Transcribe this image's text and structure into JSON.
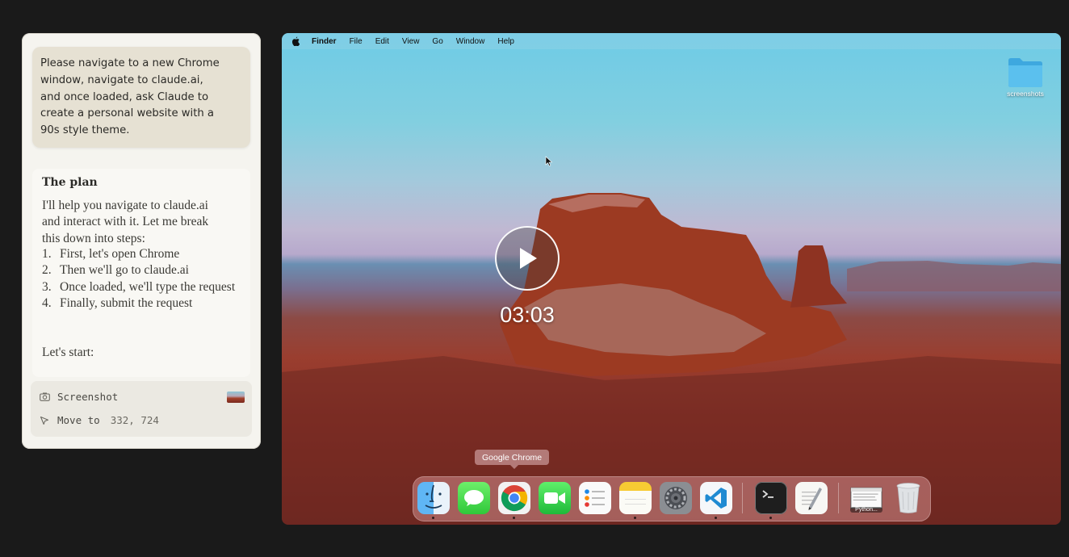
{
  "chat": {
    "user_message": "Please navigate to a new Chrome\nwindow, navigate to claude.ai,\nand once loaded, ask Claude to\ncreate a personal website with a\n90s style theme.",
    "plan_title": "The plan",
    "plan_intro": "I'll help you navigate to claude.ai\nand interact with it. Let me break\nthis down into steps:",
    "steps": [
      {
        "num": "1.",
        "text": "First, let's open Chrome"
      },
      {
        "num": "2.",
        "text": "Then we'll go to claude.ai"
      },
      {
        "num": "3.",
        "text": "Once loaded, we'll type the request"
      },
      {
        "num": "4.",
        "text": "Finally, submit the request"
      }
    ],
    "plan_outro": "Let's start:",
    "tools": {
      "screenshot_label": "Screenshot",
      "move_label": "Move to",
      "move_coords": "332, 724"
    }
  },
  "desktop": {
    "menubar": {
      "app": "Finder",
      "items": [
        "File",
        "Edit",
        "View",
        "Go",
        "Window",
        "Help"
      ]
    },
    "folder_label": "screenshots",
    "video_time": "03:03",
    "dock_tooltip": "Google Chrome",
    "dock": {
      "python_label": "Python..."
    }
  },
  "colors": {
    "chat_bg": "#f5f4ef",
    "user_bubble": "#e6e1d3",
    "page_bg": "#1a1a1a"
  }
}
